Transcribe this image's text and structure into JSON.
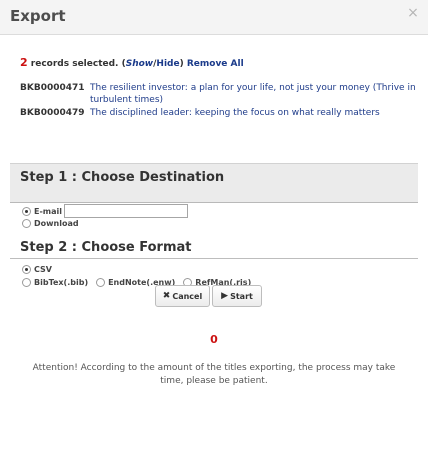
{
  "dialog": {
    "title": "Export",
    "close_glyph": "×"
  },
  "selection": {
    "count": "2",
    "text": " records selected. (",
    "show_label": "Show",
    "separator": "/",
    "hide_label": "Hide",
    "close_paren": ") ",
    "remove_all_label": "Remove All"
  },
  "records": [
    {
      "id": "BKB0000471",
      "title": "The resilient investor: a plan for your life, not just your money (Thrive in turbulent times)"
    },
    {
      "id": "BKB0000479",
      "title": "The disciplined leader: keeping the focus on what really matters"
    }
  ],
  "step1": {
    "title": "Step 1 : Choose Destination",
    "email_label": "E-mail",
    "email_value": "",
    "email_selected": true,
    "download_label": "Download",
    "download_selected": false
  },
  "step2": {
    "title": "Step 2 : Choose Format",
    "formats": [
      {
        "label": "CSV",
        "selected": true
      },
      {
        "label": "BibTex(.bib)",
        "selected": false
      },
      {
        "label": "EndNote(.enw)",
        "selected": false
      },
      {
        "label": "RefMan(.ris)",
        "selected": false
      }
    ]
  },
  "actions": {
    "cancel_label": "Cancel",
    "cancel_icon": "x-icon",
    "start_label": "Start",
    "start_icon": "play-icon"
  },
  "progress": {
    "value": "0"
  },
  "attention": {
    "text": "Attention! According to the amount of the titles exporting, the process may take time, please be patient."
  },
  "colors": {
    "link": "#1f3c8a",
    "accent_red": "#cc1111",
    "panel_bg": "#ebebeb"
  }
}
